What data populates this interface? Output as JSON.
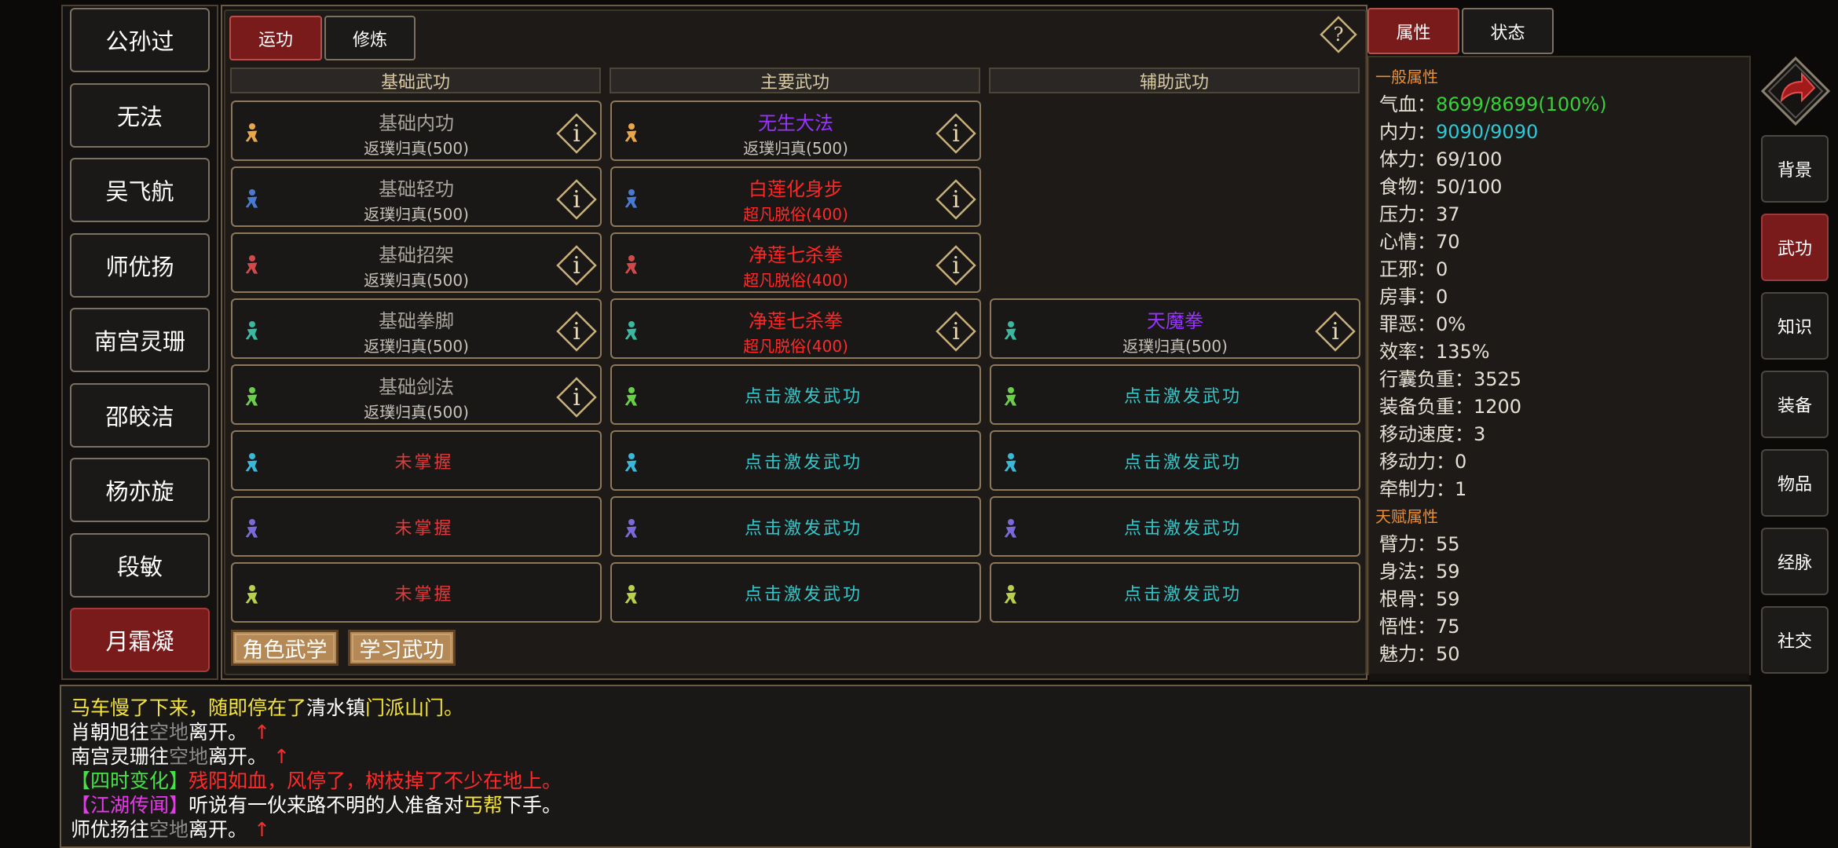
{
  "characters": [
    "公孙过",
    "无法",
    "吴飞航",
    "师优扬",
    "南宫灵珊",
    "邵皎洁",
    "杨亦旋",
    "段敏",
    "月霜凝"
  ],
  "active_character_index": 8,
  "tabs": {
    "yungong": "运功",
    "xiulian": "修炼"
  },
  "help_glyph": "?",
  "columns": {
    "basic": "基础武功",
    "main": "主要武功",
    "aux": "辅助武功"
  },
  "basic_slots": [
    {
      "name": "基础内功",
      "level": "返璞归真(500)"
    },
    {
      "name": "基础轻功",
      "level": "返璞归真(500)"
    },
    {
      "name": "基础招架",
      "level": "返璞归真(500)"
    },
    {
      "name": "基础拳脚",
      "level": "返璞归真(500)"
    },
    {
      "name": "基础剑法",
      "level": "返璞归真(500)"
    },
    {
      "name": "未掌握"
    },
    {
      "name": "未掌握"
    },
    {
      "name": "未掌握"
    }
  ],
  "main_slots": [
    {
      "name": "无生大法",
      "level": "返璞归真(500)"
    },
    {
      "name": "白莲化身步",
      "level": "超凡脱俗(400)"
    },
    {
      "name": "净莲七杀拳",
      "level": "超凡脱俗(400)"
    },
    {
      "name": "净莲七杀拳",
      "level": "超凡脱俗(400)"
    },
    {
      "name": "点击激发武功"
    },
    {
      "name": "点击激发武功"
    },
    {
      "name": "点击激发武功"
    },
    {
      "name": "点击激发武功"
    }
  ],
  "aux_slots": [
    {
      "name": "天魔拳",
      "level": "返璞归真(500)"
    },
    {
      "name": "点击激发武功"
    },
    {
      "name": "点击激发武功"
    },
    {
      "name": "点击激发武功"
    },
    {
      "name": "点击激发武功"
    }
  ],
  "info_glyph": "i",
  "buttons": {
    "role_martial": "角色武学",
    "learn_martial": "学习武功"
  },
  "attr_tabs": {
    "attributes": "属性",
    "status": "状态"
  },
  "general_title": "一般属性",
  "general": [
    {
      "label": "气血：",
      "value": "8699/8699(100%)"
    },
    {
      "label": "内力：",
      "value": "9090/9090"
    },
    {
      "label": "体力：",
      "value": "69/100"
    },
    {
      "label": "食物：",
      "value": "50/100"
    },
    {
      "label": "压力：",
      "value": "37"
    },
    {
      "label": "心情：",
      "value": "70"
    },
    {
      "label": "正邪：",
      "value": "0"
    },
    {
      "label": "房事：",
      "value": "0"
    },
    {
      "label": "罪恶：",
      "value": "0%"
    },
    {
      "label": "效率：",
      "value": "135%"
    },
    {
      "label": "行囊负重：",
      "value": "3525"
    },
    {
      "label": "装备负重：",
      "value": "1200"
    },
    {
      "label": "移动速度：",
      "value": "3"
    },
    {
      "label": "移动力：",
      "value": "0"
    },
    {
      "label": "牵制力：",
      "value": "1"
    }
  ],
  "talent_title": "天赋属性",
  "talent": [
    {
      "label": "臂力：",
      "value": "55"
    },
    {
      "label": "身法：",
      "value": "59"
    },
    {
      "label": "根骨：",
      "value": "59"
    },
    {
      "label": "悟性：",
      "value": "75"
    },
    {
      "label": "魅力：",
      "value": "50"
    }
  ],
  "nav": [
    "背景",
    "武功",
    "知识",
    "装备",
    "物品",
    "经脉",
    "社交"
  ],
  "nav_active_index": 1,
  "log": {
    "line1": {
      "a": "马车慢了下来，随即停在了",
      "b": "清水镇",
      "c": "门派山门。"
    },
    "line2": {
      "a": "肖朝旭往",
      "b": "空地",
      "c": "离开。",
      "d": "↑"
    },
    "line3": {
      "a": "南宫灵珊往",
      "b": "空地",
      "c": "离开。",
      "d": "↑"
    },
    "line4": {
      "a": "【四时变化】",
      "b": "残阳如血，风停了，树枝掉了不少在地上。"
    },
    "line5": {
      "a": "【江湖传闻】",
      "b": "听说有一伙来路不明的人准备对",
      "c": "丐帮",
      "d": "下手。"
    },
    "line6": {
      "a": "师优扬往",
      "b": "空地",
      "c": "离开。",
      "d": "↑"
    }
  },
  "colors": {
    "active_red": "#7a1b1b",
    "frame_gold": "#8d785a",
    "purple_skill": "#9933ff",
    "red_skill": "#ff2626",
    "cyan_hint": "#36c6c9",
    "hp_green": "#3ad03a",
    "mp_cyan": "#2ec9d6",
    "section_orange": "#e88f3a"
  },
  "icons": [
    "figure-icon",
    "info-icon",
    "help-icon",
    "return-arrow-icon"
  ]
}
